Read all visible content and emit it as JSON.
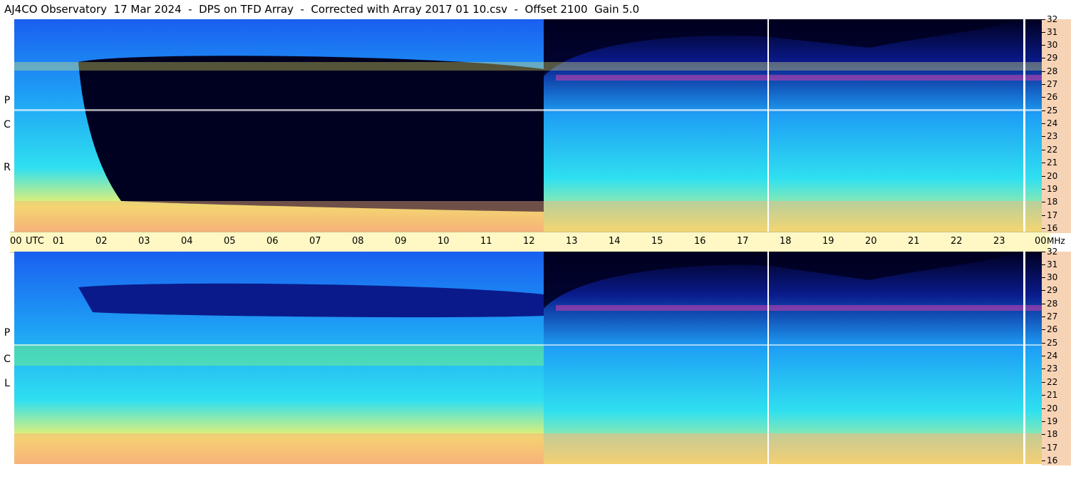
{
  "header": {
    "title": "AJ4CO Observatory  17 Mar 2024  -  DPS on TFD Array  -  Corrected with Array 2017 01 10.csv  -  Offset 2100  Gain 5.0"
  },
  "panels": [
    {
      "id": "rcp",
      "letters": [
        "R",
        "C",
        "P"
      ]
    },
    {
      "id": "lcp",
      "letters": [
        "L",
        "C",
        "P"
      ]
    }
  ],
  "time_axis": {
    "labels": [
      "00",
      "UTC",
      "01",
      "02",
      "03",
      "04",
      "05",
      "06",
      "07",
      "08",
      "09",
      "10",
      "11",
      "12",
      "13",
      "14",
      "15",
      "16",
      "17",
      "18",
      "19",
      "20",
      "21",
      "22",
      "23",
      "00",
      "MHz"
    ]
  },
  "freq_axis": {
    "labels": [
      "32",
      "31",
      "30",
      "29",
      "28",
      "27",
      "26",
      "25",
      "24",
      "23",
      "22",
      "21",
      "20",
      "19",
      "18",
      "17",
      "16"
    ]
  },
  "colors": {
    "deep": "#000020",
    "dark_blue": "#0a1a8a",
    "blue": "#1a5ff0",
    "light_blue": "#1e9ef5",
    "cyan": "#2fe0f0",
    "green": "#6af08a",
    "yellow": "#f2f26a",
    "orange": "#f7b27a",
    "pink": "#ff3fb0",
    "time_band": "#fff8c4",
    "freq_band": "#f7d3b5"
  },
  "chart_data": {
    "type": "heatmap",
    "title": "AJ4CO Observatory  17 Mar 2024  -  DPS on TFD Array  -  Corrected with Array 2017 01 10.csv  -  Offset 2100  Gain 5.0",
    "x": {
      "unit": "UTC",
      "range": [
        0,
        24
      ],
      "ticks": [
        "00",
        "01",
        "02",
        "03",
        "04",
        "05",
        "06",
        "07",
        "08",
        "09",
        "10",
        "11",
        "12",
        "13",
        "14",
        "15",
        "16",
        "17",
        "18",
        "19",
        "20",
        "21",
        "22",
        "23",
        "00"
      ]
    },
    "y": {
      "unit": "MHz",
      "range": [
        16,
        32
      ],
      "ticks": [
        32,
        31,
        30,
        29,
        28,
        27,
        26,
        25,
        24,
        23,
        22,
        21,
        20,
        19,
        18,
        17,
        16
      ]
    },
    "panels": [
      "RCP",
      "LCP"
    ],
    "colorscale": [
      "#000020",
      "#0a1a8a",
      "#1a5ff0",
      "#1e9ef5",
      "#2fe0f0",
      "#6af08a",
      "#f2f26a",
      "#f7b27a",
      "#ff3fb0"
    ]
  }
}
